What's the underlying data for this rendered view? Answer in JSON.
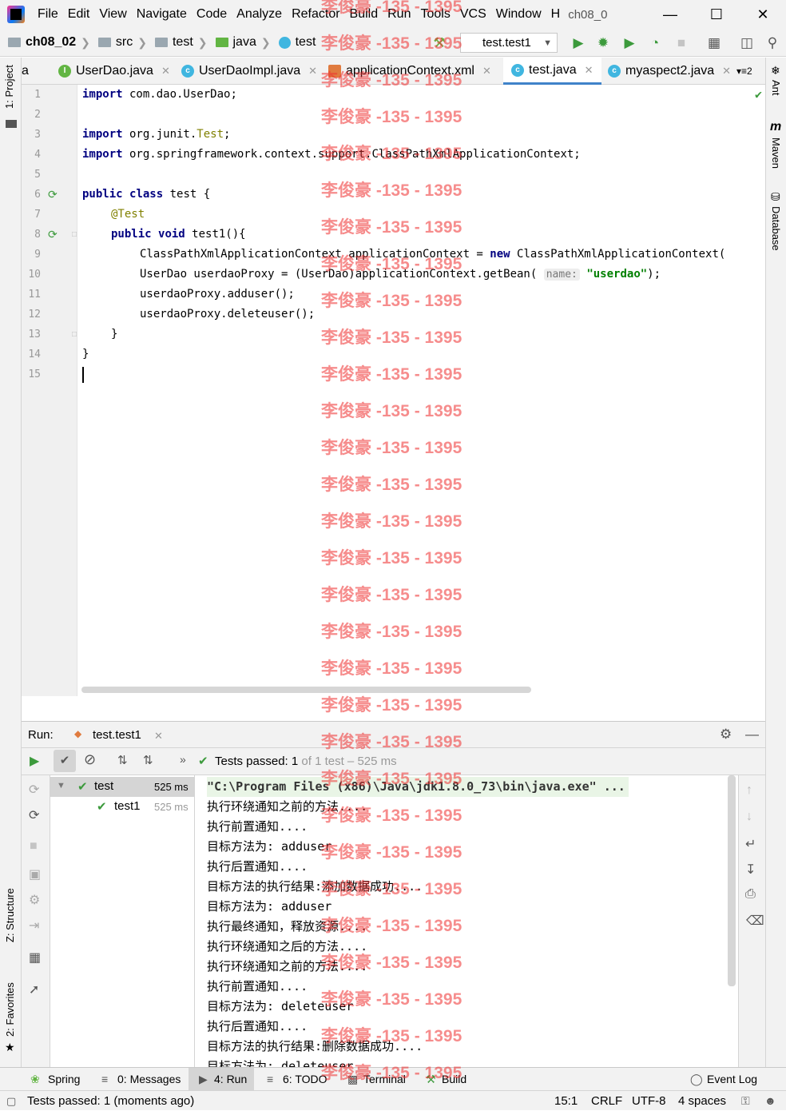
{
  "menu": {
    "items": [
      "File",
      "Edit",
      "View",
      "Navigate",
      "Code",
      "Analyze",
      "Refactor",
      "Build",
      "Run",
      "Tools",
      "VCS",
      "Window",
      "H"
    ],
    "title": "ch08_0"
  },
  "nav": {
    "crumbs": [
      "ch08_02",
      "src",
      "test",
      "java",
      "test"
    ],
    "run_config": "test.test1"
  },
  "tabs": [
    {
      "label": "a",
      "icon": "java-icon"
    },
    {
      "label": "UserDao.java",
      "icon": "interface-icon"
    },
    {
      "label": "UserDaoImpl.java",
      "icon": "class-icon"
    },
    {
      "label": "applicationContext.xml",
      "icon": "xml-icon"
    },
    {
      "label": "test.java",
      "icon": "class-icon"
    },
    {
      "label": "myaspect2.java",
      "icon": "class-icon"
    }
  ],
  "tabs_more": "2",
  "side_left": {
    "project": "1: Project",
    "structure": "Z: Structure",
    "favorites": "2: Favorites"
  },
  "side_right": {
    "ant": "Ant",
    "maven": "Maven",
    "database": "Database"
  },
  "code": {
    "line_numbers": [
      "1",
      "2",
      "3",
      "4",
      "5",
      "6",
      "7",
      "8",
      "9",
      "10",
      "11",
      "12",
      "13",
      "14",
      "15"
    ],
    "l1_kw": "import",
    "l1": " com.dao.UserDao;",
    "l3_kw": "import",
    "l3a": " org.junit.",
    "l3b": "Test",
    ";": ";",
    "l4_kw": "import",
    "l4": " org.springframework.context.support.ClassPathXmlApplicationContext;",
    "l6_kw1": "public",
    "l6_kw2": "class",
    "l6": " test {",
    "l7": "@Test",
    "l8_kw1": "public",
    "l8_kw2": "void",
    "l8": " test1(){",
    "l9a": "ClassPathXmlApplicationContext applicationContext = ",
    "l9_kw": "new",
    "l9b": " ClassPathXmlApplicationContext(",
    "l10a": "UserDao userdaoProxy = (UserDao)applicationContext.getBean( ",
    "l10_hint": "name:",
    "l10_str": "\"userdao\"",
    "l10b": ");",
    "l11": "userdaoProxy.adduser();",
    "l12": "userdaoProxy.deleteuser();",
    "l13": "}",
    "l14": "}"
  },
  "run": {
    "label": "Run:",
    "tab": "test.test1",
    "status_prefix": "Tests passed: ",
    "status_count": "1",
    "status_rest": " of 1 test – 525 ms",
    "tree": [
      {
        "name": "test",
        "time": "525 ms"
      },
      {
        "name": "test1",
        "time": "525 ms"
      }
    ],
    "console": [
      "\"C:\\Program Files (x86)\\Java\\jdk1.8.0_73\\bin\\java.exe\" ...",
      "执行环绕通知之前的方法....",
      "执行前置通知....",
      "目标方法为: adduser",
      "执行后置通知....",
      "目标方法的执行结果:添加数据成功....",
      "目标方法为: adduser",
      "执行最终通知，释放资源....",
      "执行环绕通知之后的方法....",
      "执行环绕通知之前的方法....",
      "执行前置通知....",
      "目标方法为: deleteuser",
      "执行后置通知....",
      "目标方法的执行结果:删除数据成功....",
      "目标方法为: deleteuser"
    ]
  },
  "bottom_tabs": [
    "Spring",
    "0: Messages",
    "4: Run",
    "6: TODO",
    "Terminal",
    "Build",
    "Event Log"
  ],
  "status": {
    "message": "Tests passed: 1 (moments ago)",
    "position": "15:1",
    "line_sep": "CRLF",
    "encoding": "UTF-8",
    "indent": "4 spaces"
  },
  "watermark": "李俊豪 -135 - 1395",
  "colors": {
    "accent": "#4083c9",
    "pass": "#3c9a3c",
    "watermark": "#f03030"
  }
}
